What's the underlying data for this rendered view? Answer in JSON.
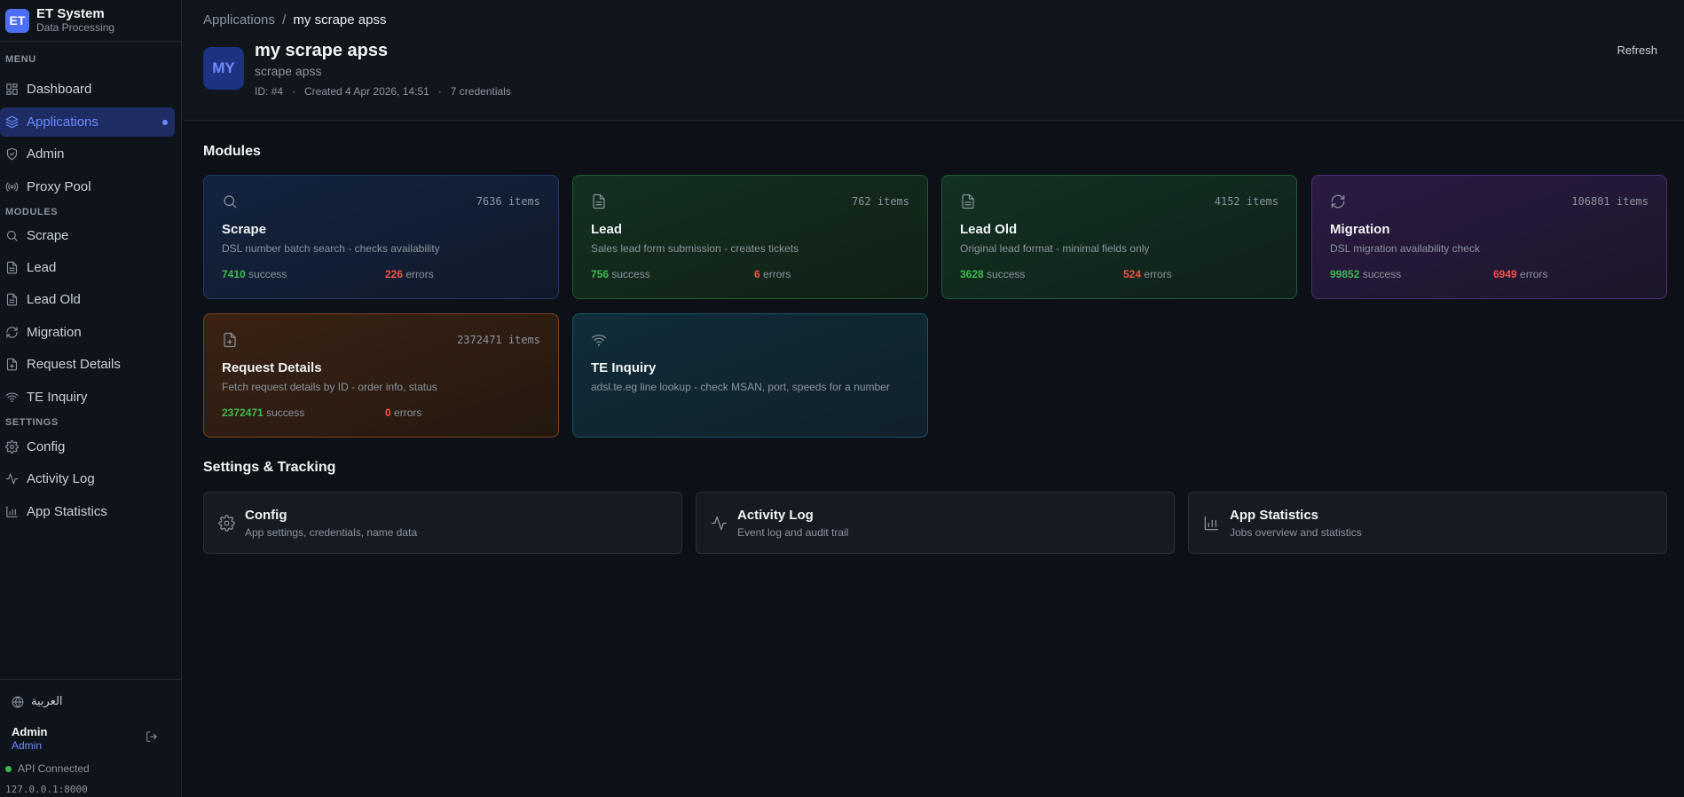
{
  "brand": {
    "logo": "ET",
    "title": "ET System",
    "subtitle": "Data Processing"
  },
  "sidebar": {
    "menu_label": "MENU",
    "menu": [
      {
        "label": "Dashboard",
        "icon": "grid-icon"
      },
      {
        "label": "Applications",
        "icon": "layers-icon",
        "active": true
      },
      {
        "label": "Admin",
        "icon": "shield-icon"
      },
      {
        "label": "Proxy Pool",
        "icon": "broadcast-icon"
      }
    ],
    "modules_label": "MODULES",
    "modules": [
      {
        "label": "Scrape",
        "icon": "search-icon"
      },
      {
        "label": "Lead",
        "icon": "file-icon"
      },
      {
        "label": "Lead Old",
        "icon": "file-icon"
      },
      {
        "label": "Migration",
        "icon": "refresh-icon"
      },
      {
        "label": "Request Details",
        "icon": "file-plus-icon"
      },
      {
        "label": "TE Inquiry",
        "icon": "wifi-icon"
      }
    ],
    "settings_label": "SETTINGS",
    "settings": [
      {
        "label": "Config",
        "icon": "gear-icon"
      },
      {
        "label": "Activity Log",
        "icon": "activity-icon"
      },
      {
        "label": "App Statistics",
        "icon": "bar-chart-icon"
      }
    ],
    "language": "العربية",
    "user_name": "Admin",
    "user_role": "Admin",
    "api_status": "API Connected",
    "api_host": "127.0.0.1:8000"
  },
  "header": {
    "breadcrumb_root": "Applications",
    "breadcrumb_sep": "/",
    "breadcrumb_current": "my scrape apss",
    "avatar": "MY",
    "title": "my scrape apss",
    "subtitle": "scrape apss",
    "meta": "ID: #4   ·   Created 4 Apr 2026, 14:51   ·   7 credentials",
    "refresh": "Refresh"
  },
  "modules_heading": "Modules",
  "modules": [
    {
      "key": "scrape",
      "title": "Scrape",
      "items": "7636 items",
      "desc": "DSL number batch search - checks availability",
      "success": "7410",
      "errors": "226"
    },
    {
      "key": "lead",
      "title": "Lead",
      "items": "762 items",
      "desc": "Sales lead form submission - creates tickets",
      "success": "756",
      "errors": "6"
    },
    {
      "key": "leadold",
      "title": "Lead Old",
      "items": "4152 items",
      "desc": "Original lead format - minimal fields only",
      "success": "3628",
      "errors": "524"
    },
    {
      "key": "migration",
      "title": "Migration",
      "items": "106801 items",
      "desc": "DSL migration availability check",
      "success": "99852",
      "errors": "6949"
    },
    {
      "key": "request",
      "title": "Request Details",
      "items": "2372471 items",
      "desc": "Fetch request details by ID - order info, status",
      "success": "2372471",
      "errors": "0"
    },
    {
      "key": "te",
      "title": "TE Inquiry",
      "desc": "adsl.te.eg line lookup - check MSAN, port, speeds for a number"
    }
  ],
  "success_word": "success",
  "errors_word": "errors",
  "settings_heading": "Settings & Tracking",
  "settings_cards": [
    {
      "title": "Config",
      "desc": "App settings, credentials, name data"
    },
    {
      "title": "Activity Log",
      "desc": "Event log and audit trail"
    },
    {
      "title": "App Statistics",
      "desc": "Jobs overview and statistics"
    }
  ],
  "colors": {
    "accent": "#4f6ef7",
    "success": "#3fb950",
    "error": "#f85149"
  }
}
